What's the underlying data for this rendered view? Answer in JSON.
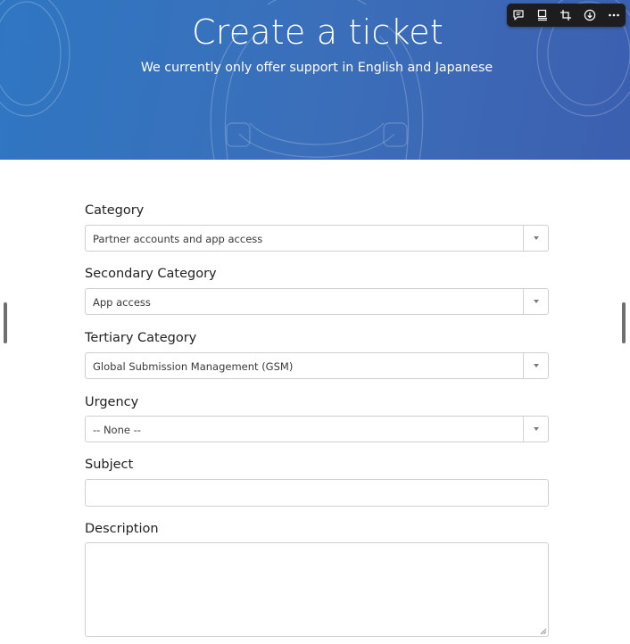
{
  "hero": {
    "title": "Create a ticket",
    "subtitle": "We currently only offer support in English and Japanese"
  },
  "toolbar": {
    "icons": [
      "comment-icon",
      "slideshow-icon",
      "crop-icon",
      "download-icon",
      "more-icon"
    ]
  },
  "form": {
    "category": {
      "label": "Category",
      "value": "Partner accounts and app access"
    },
    "secondary_category": {
      "label": "Secondary Category",
      "value": "App access"
    },
    "tertiary_category": {
      "label": "Tertiary Category",
      "value": "Global Submission Management (GSM)"
    },
    "urgency": {
      "label": "Urgency",
      "value": "-- None --"
    },
    "subject": {
      "label": "Subject",
      "value": ""
    },
    "description": {
      "label": "Description",
      "value": ""
    }
  },
  "colors": {
    "hero_start": "#2f76c2",
    "hero_end": "#3c5fb0",
    "toolbar_bg": "#1d1d1f",
    "border": "#cfcfcf"
  }
}
